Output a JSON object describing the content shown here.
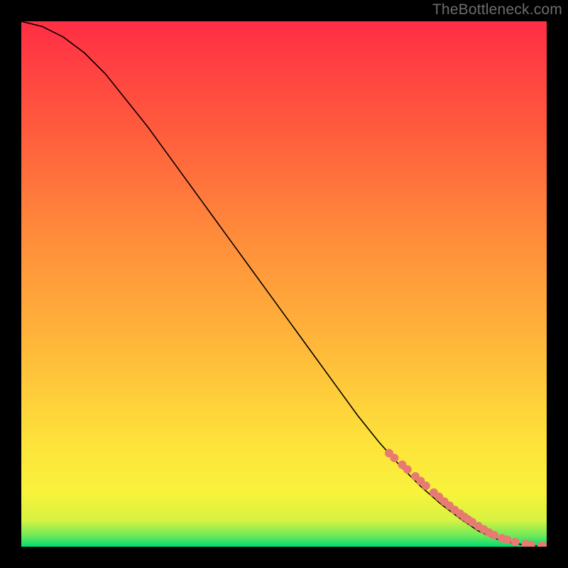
{
  "watermark": "TheBottleneck.com",
  "chart_data": {
    "type": "line",
    "title": "",
    "xlabel": "",
    "ylabel": "",
    "xlim": [
      0,
      100
    ],
    "ylim": [
      0,
      100
    ],
    "background_gradient": {
      "stops": [
        {
          "y": 0,
          "color": "#00de77"
        },
        {
          "y": 2,
          "color": "#6ee95a"
        },
        {
          "y": 5,
          "color": "#d8f241"
        },
        {
          "y": 10,
          "color": "#f8f33b"
        },
        {
          "y": 20,
          "color": "#fde23a"
        },
        {
          "y": 40,
          "color": "#ffb43a"
        },
        {
          "y": 60,
          "color": "#ff8a3b"
        },
        {
          "y": 80,
          "color": "#ff5a3d"
        },
        {
          "y": 100,
          "color": "#ff2e45"
        }
      ]
    },
    "series": [
      {
        "name": "curve",
        "stroke": "#000000",
        "x": [
          0,
          4,
          8,
          12,
          16,
          20,
          24,
          28,
          32,
          36,
          40,
          44,
          48,
          52,
          56,
          60,
          64,
          68,
          72,
          76,
          80,
          84,
          87,
          90,
          93,
          96,
          99,
          100
        ],
        "y": [
          100,
          99,
          97,
          94,
          90,
          85,
          80,
          74.5,
          69,
          63.5,
          58,
          52.5,
          47,
          41.5,
          36,
          30.5,
          25,
          20,
          15.5,
          11.5,
          8,
          5,
          3,
          1.6,
          0.8,
          0.3,
          0.1,
          0.05
        ]
      }
    ],
    "scatter": {
      "name": "markers",
      "color": "#e77b72",
      "radius": 6,
      "x": [
        70,
        71,
        72.5,
        73.5,
        75,
        76,
        77,
        78.5,
        79.5,
        80.5,
        81.5,
        82.5,
        83.5,
        84.3,
        85,
        85.8,
        87,
        88,
        89,
        90,
        91.5,
        92.5,
        94,
        96,
        97,
        99,
        100
      ],
      "y": [
        17.8,
        16.9,
        15.6,
        14.7,
        13.4,
        12.5,
        11.6,
        10.3,
        9.5,
        8.6,
        7.8,
        7.0,
        6.3,
        5.7,
        5.2,
        4.7,
        3.9,
        3.3,
        2.7,
        2.2,
        1.6,
        1.3,
        0.9,
        0.5,
        0.35,
        0.15,
        0.1
      ]
    }
  }
}
